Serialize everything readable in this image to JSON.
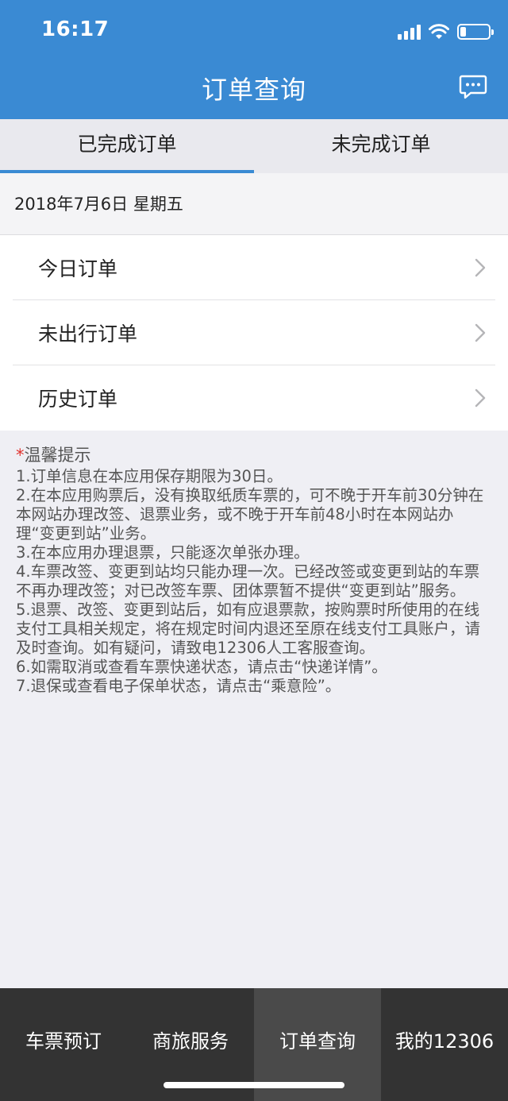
{
  "status_bar": {
    "time": "16:17",
    "battery_level": 0.2
  },
  "nav": {
    "title": "订单查询",
    "message_icon": "chat-bubble-icon"
  },
  "tabs": [
    {
      "label": "已完成订单",
      "active": true
    },
    {
      "label": "未完成订单",
      "active": false
    }
  ],
  "date": "2018年7月6日  星期五",
  "menu": [
    {
      "label": "今日订单"
    },
    {
      "label": "未出行订单"
    },
    {
      "label": "历史订单"
    }
  ],
  "tips": {
    "star": "*",
    "title": "温馨提示",
    "items": [
      "1.订单信息在本应用保存期限为30日。",
      "2.在本应用购票后，没有换取纸质车票的，可不晚于开车前30分钟在本网站办理改签、退票业务，或不晚于开车前48小时在本网站办理“变更到站”业务。",
      "3.在本应用办理退票，只能逐次单张办理。",
      "4.车票改签、变更到站均只能办理一次。已经改签或变更到站的车票不再办理改签；对已改签车票、团体票暂不提供“变更到站”服务。",
      "5.退票、改签、变更到站后，如有应退票款，按购票时所使用的在线支付工具相关规定，将在规定时间内退还至原在线支付工具账户，请及时查询。如有疑问，请致电12306人工客服查询。",
      "6.如需取消或查看车票快递状态，请点击“快递详情”。",
      "7.退保或查看电子保单状态，请点击“乘意险”。"
    ]
  },
  "tabbar": [
    {
      "label": "车票预订",
      "active": false
    },
    {
      "label": "商旅服务",
      "active": false
    },
    {
      "label": "订单查询",
      "active": true
    },
    {
      "label": "我的12306",
      "active": false
    }
  ],
  "colors": {
    "primary": "#3a8ad3",
    "tabbar_bg": "#333333",
    "tip_star": "#e0312d"
  }
}
